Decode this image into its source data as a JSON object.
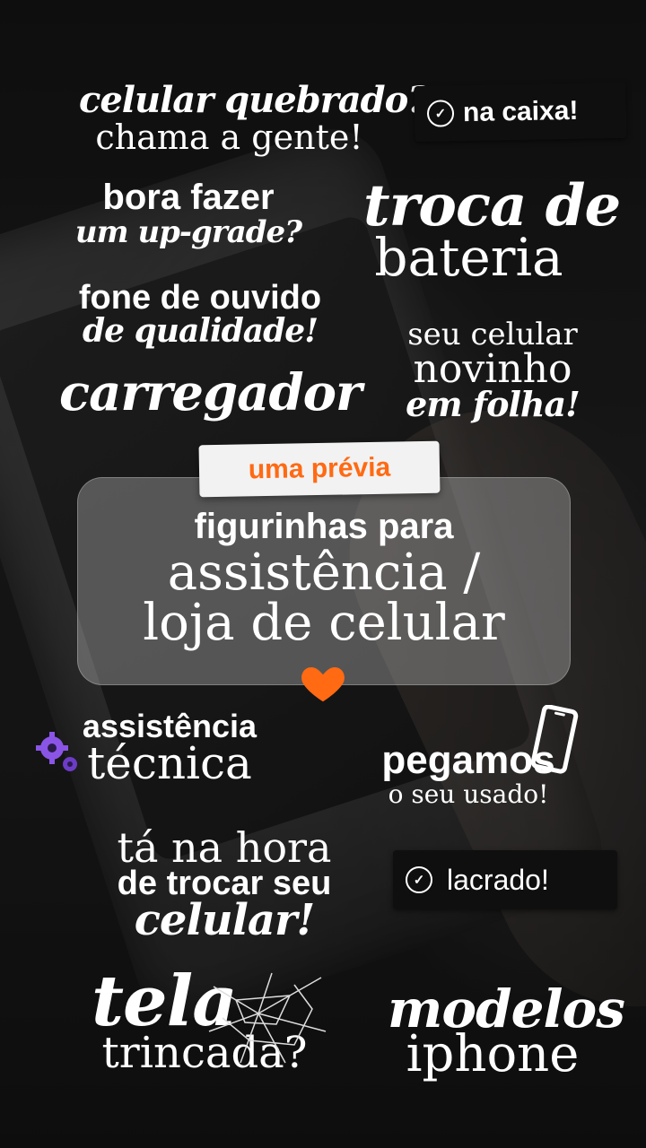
{
  "stickers": {
    "celular_quebrado": {
      "line1": "celular quebrado?",
      "line2": "chama a gente!"
    },
    "na_caixa": {
      "label": "na caixa!",
      "icon": "verified-badge-icon"
    },
    "upgrade": {
      "line1": "bora fazer",
      "line2": "um up-grade?"
    },
    "troca_bateria": {
      "line1": "troca de",
      "line2": "bateria"
    },
    "fone": {
      "line1": "fone de ouvido",
      "line2": "de qualidade!"
    },
    "carregador": {
      "label": "carregador"
    },
    "novinho": {
      "line1": "seu celular",
      "line2": "novinho",
      "line3": "em folha!"
    },
    "assistencia_tecnica": {
      "line1": "assistência",
      "line2": "técnica",
      "icon": "gears-icon"
    },
    "pegamos": {
      "line1": "pegamos",
      "line2": "o seu usado!",
      "icon": "phone-outline-icon"
    },
    "hora_trocar": {
      "line1": "tá na hora",
      "line2": "de trocar seu",
      "line3": "celular!"
    },
    "lacrado": {
      "label": "lacrado!",
      "icon": "verified-badge-icon"
    },
    "tela_trincada": {
      "line1": "tela",
      "line2": "trincada?",
      "icon": "cracked-glass-icon"
    },
    "modelos_iphone": {
      "line1": "modelos",
      "line2": "iphone"
    }
  },
  "center": {
    "tag": "uma prévia",
    "line1": "figurinhas para",
    "line2": "assistência /",
    "line3": "loja de celular"
  },
  "colors": {
    "accent": "#ff6a13",
    "text": "#ffffff",
    "background": "#1b1b1b"
  }
}
